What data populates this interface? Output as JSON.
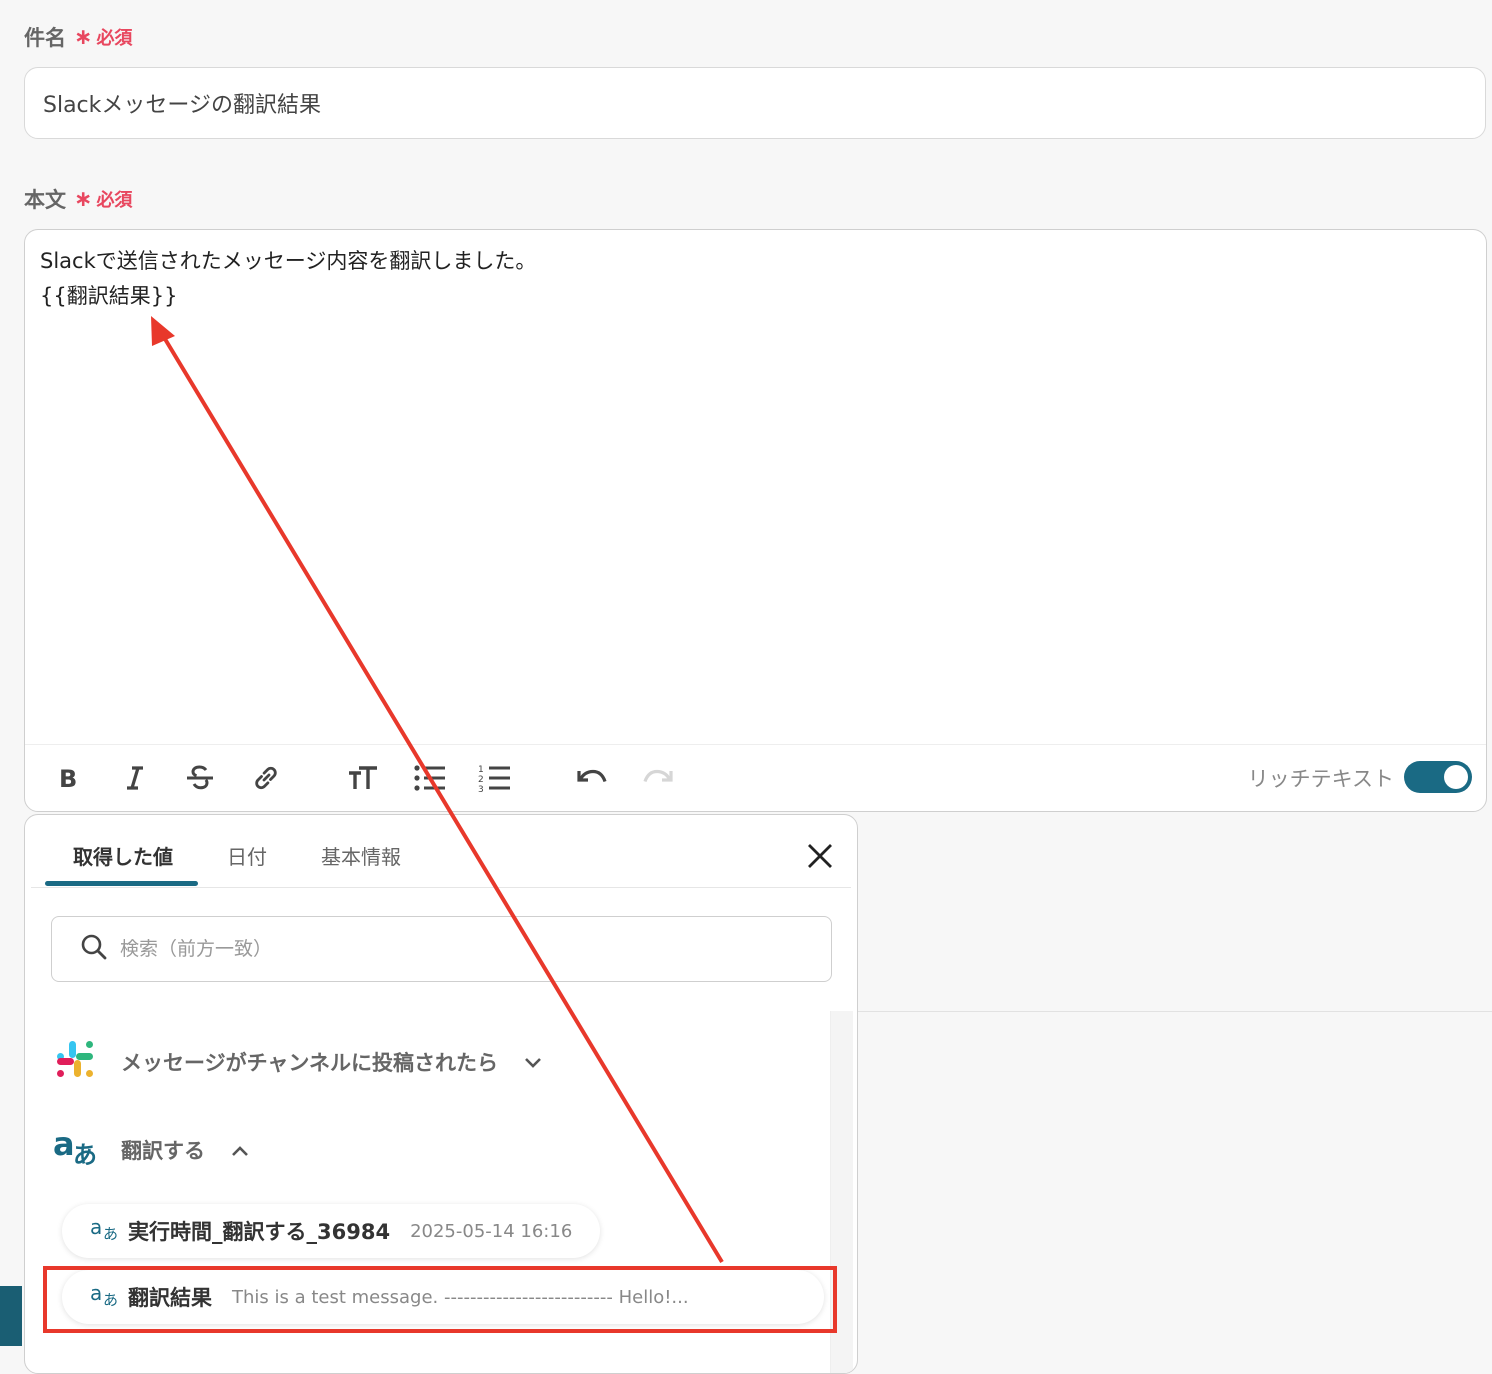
{
  "subject": {
    "label": "件名",
    "required_text": "必須",
    "value": "Slackメッセージの翻訳結果"
  },
  "body": {
    "label": "本文",
    "required_text": "必須",
    "line1": "Slackで送信されたメッセージ内容を翻訳しました。",
    "line2": "{{翻訳結果}}"
  },
  "toolbar": {
    "buttons": [
      "bold-icon",
      "italic-icon",
      "strikethrough-icon",
      "link-icon",
      "text-size-icon",
      "bullet-list-icon",
      "numbered-list-icon",
      "undo-icon",
      "redo-icon"
    ],
    "rich_text_label": "リッチテキスト",
    "rich_text_enabled": true
  },
  "panel": {
    "tabs": [
      {
        "label": "取得した値",
        "active": true
      },
      {
        "label": "日付",
        "active": false
      },
      {
        "label": "基本情報",
        "active": false
      }
    ],
    "search_placeholder": "検索（前方一致）",
    "groups": [
      {
        "icon": "slack-icon",
        "label": "メッセージがチャンネルに投稿されたら",
        "expanded": false
      },
      {
        "icon": "translate-icon",
        "label": "翻訳する",
        "expanded": true
      }
    ],
    "items": [
      {
        "name": "実行時間_翻訳する_36984",
        "value": "2025-05-14 16:16"
      },
      {
        "name": "翻訳結果",
        "value": "This is a test message. -------------------------- Hello!..."
      }
    ]
  },
  "colors": {
    "accent": "#1a6a84",
    "required": "#e8475f",
    "annotation": "#e8382b"
  }
}
